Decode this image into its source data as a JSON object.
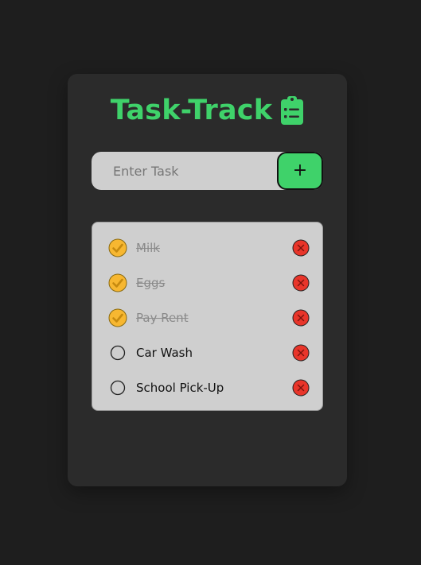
{
  "app": {
    "title": "Task-Track",
    "accent_color": "#3fd26a",
    "check_color": "#f7b731",
    "delete_color": "#e8352a"
  },
  "input": {
    "placeholder": "Enter Task",
    "value": "",
    "add_label": "+"
  },
  "tasks": [
    {
      "label": "Milk",
      "done": true
    },
    {
      "label": "Eggs",
      "done": true
    },
    {
      "label": "Pay Rent",
      "done": true
    },
    {
      "label": "Car Wash",
      "done": false
    },
    {
      "label": "School Pick-Up",
      "done": false
    }
  ],
  "icons": {
    "title_icon": "clipboard-list-icon",
    "checked_icon": "check-circle-icon",
    "unchecked_icon": "empty-circle-icon",
    "delete_icon": "x-circle-icon"
  }
}
